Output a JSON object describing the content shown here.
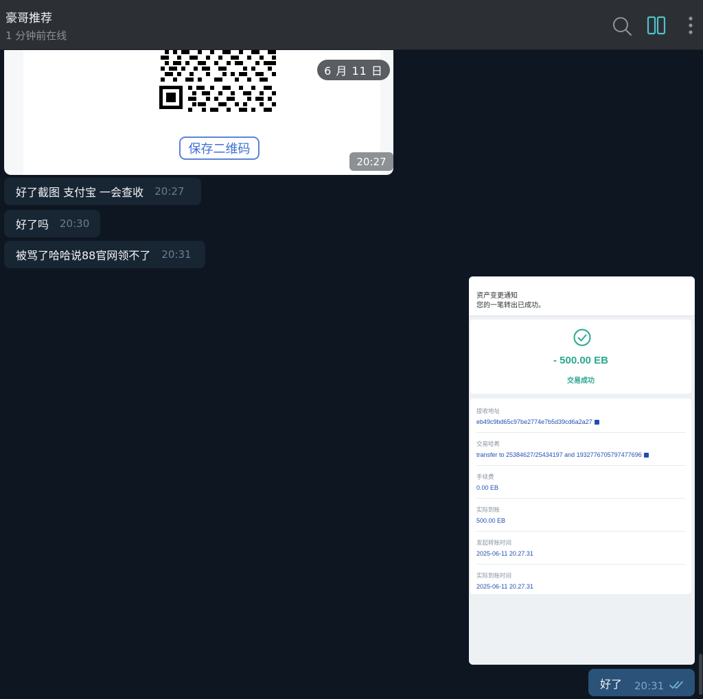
{
  "header": {
    "title": "豪哥推荐",
    "status": "1 分钟前在线",
    "icons": [
      "search-icon",
      "columns-icon",
      "more-vertical-icon"
    ],
    "accent": "#4fc3c7"
  },
  "messages": {
    "qr_image": {
      "save_label": "保存二维码",
      "date_pill": "6 月 11 日",
      "time": "20:27"
    },
    "incoming": [
      {
        "text": "好了截图  支付宝 一会查收",
        "time": "20:27"
      },
      {
        "text": "好了吗",
        "time": "20:30"
      },
      {
        "text": "被骂了哈哈说88官网领不了",
        "time": "20:31"
      }
    ],
    "screenshot": {
      "notice_title": "资产变更通知",
      "notice_body": "您的一笔转出已成功。",
      "amount": "- 500.00 EB",
      "result": "交易成功",
      "rows": [
        {
          "label": "接收地址",
          "value": "eb49c9bd65c97be2774e7b5d39cd6a2a27",
          "copy": true
        },
        {
          "label": "交易哈希",
          "value": "transfer to 25384627/25434197 and 1932776705797477696",
          "copy": true
        },
        {
          "label": "手续费",
          "value": "0.00 EB",
          "copy": false
        },
        {
          "label": "实际到账",
          "value": "500.00 EB",
          "copy": false
        },
        {
          "label": "发起转账时间",
          "value": "2025-06-11 20.27.31",
          "copy": false
        },
        {
          "label": "实际到账时间",
          "value": "2025-06-11 20.27.31",
          "copy": false
        }
      ]
    },
    "outgoing": {
      "text": "好了",
      "time": "20:31",
      "read_icon": "double-check-icon"
    }
  }
}
